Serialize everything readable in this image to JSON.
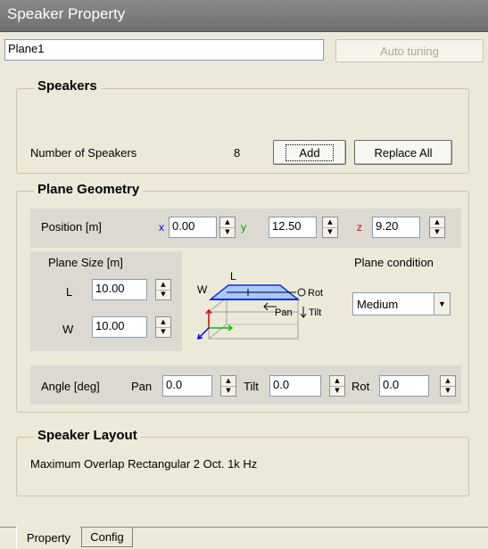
{
  "window": {
    "title": "Speaker Property"
  },
  "plane_name": {
    "value": "Plane1"
  },
  "buttons": {
    "auto_tuning": "Auto tuning",
    "add": "Add",
    "replace_all": "Replace All"
  },
  "speakers": {
    "title": "Speakers",
    "count_label": "Number of Speakers",
    "count_value": "8"
  },
  "geometry": {
    "title": "Plane Geometry",
    "position_label": "Position [m]",
    "x_label": "x",
    "x_value": "0.00",
    "y_label": "y",
    "y_value": "12.50",
    "z_label": "z",
    "z_value": "9.20",
    "plane_size_label": "Plane Size [m]",
    "l_label": "L",
    "l_value": "10.00",
    "w_label": "W",
    "w_value": "10.00",
    "diagram": {
      "w": "W",
      "l": "L",
      "rot": "Rot",
      "pan": "Pan",
      "tilt": "Tilt"
    },
    "condition_label": "Plane condition",
    "condition_value": "Medium",
    "angle_label": "Angle [deg]",
    "pan_label": "Pan",
    "pan_value": "0.0",
    "tilt_label": "Tilt",
    "tilt_value": "0.0",
    "rot_label": "Rot",
    "rot_value": "0.0"
  },
  "layout": {
    "title": "Speaker Layout",
    "text": "Maximum Overlap Rectangular 2 Oct. 1k Hz"
  },
  "tabs": [
    {
      "label": "Property"
    },
    {
      "label": "Config"
    }
  ],
  "colors": {
    "x_axis": "#0000ff",
    "y_axis": "#00a000",
    "z_axis": "#e00000",
    "titlebar": "#7a7a7a"
  }
}
